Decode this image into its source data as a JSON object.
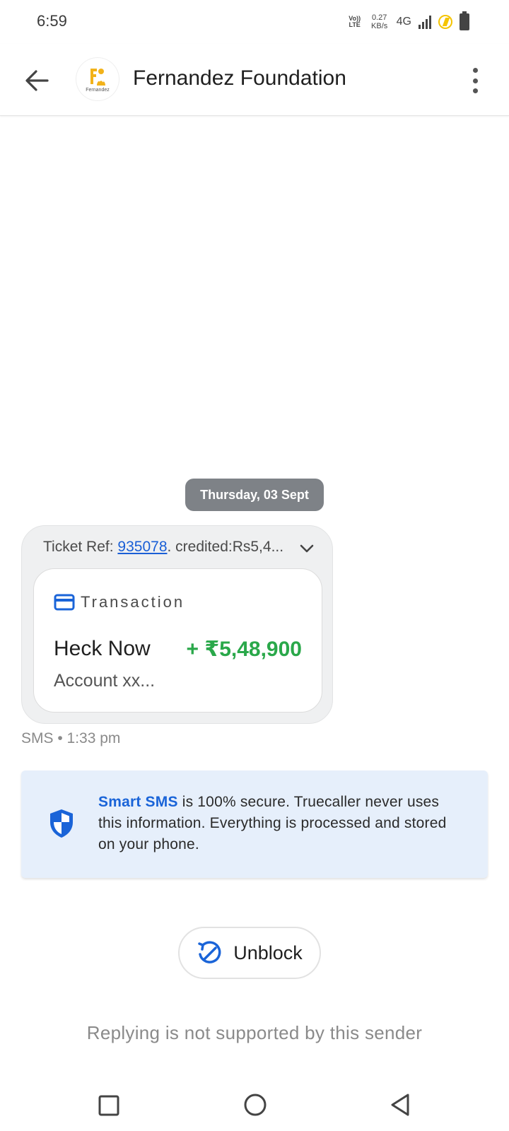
{
  "status_bar": {
    "time": "6:59",
    "volte_line1": "Vo))",
    "volte_line2": "LTE",
    "speed_line1": "0.27",
    "speed_line2": "KB/s",
    "network": "4G"
  },
  "toolbar": {
    "contact_name": "Fernandez Foundation",
    "avatar_text": "Fernandez"
  },
  "conversation": {
    "date_chip": "Thursday, 03 Sept",
    "message": {
      "preview_prefix": "Ticket Ref: ",
      "ticket_ref": "935078",
      "preview_suffix": ".  credited:Rs5,4...",
      "card": {
        "label": "Transaction",
        "title": "Heck Now",
        "amount": "+ ₹5,48,900",
        "subtitle": "Account xx..."
      },
      "meta": "SMS • 1:33 pm"
    },
    "info_banner": {
      "highlight": "Smart SMS",
      "text": " is 100% secure. Truecaller never uses this information. Everything is processed and stored on your phone."
    },
    "unblock_label": "Unblock",
    "reply_note": "Replying is not supported by this sender"
  },
  "colors": {
    "accent_blue": "#1a64d8",
    "amount_green": "#2aa84a",
    "banner_bg": "#e6effb",
    "date_chip_bg": "#7e8287"
  },
  "icons": [
    "back-arrow-icon",
    "menu-dots-icon",
    "chevron-down-icon",
    "credit-card-icon",
    "shield-icon",
    "block-icon",
    "recent-apps-icon",
    "home-icon",
    "nav-back-icon"
  ]
}
